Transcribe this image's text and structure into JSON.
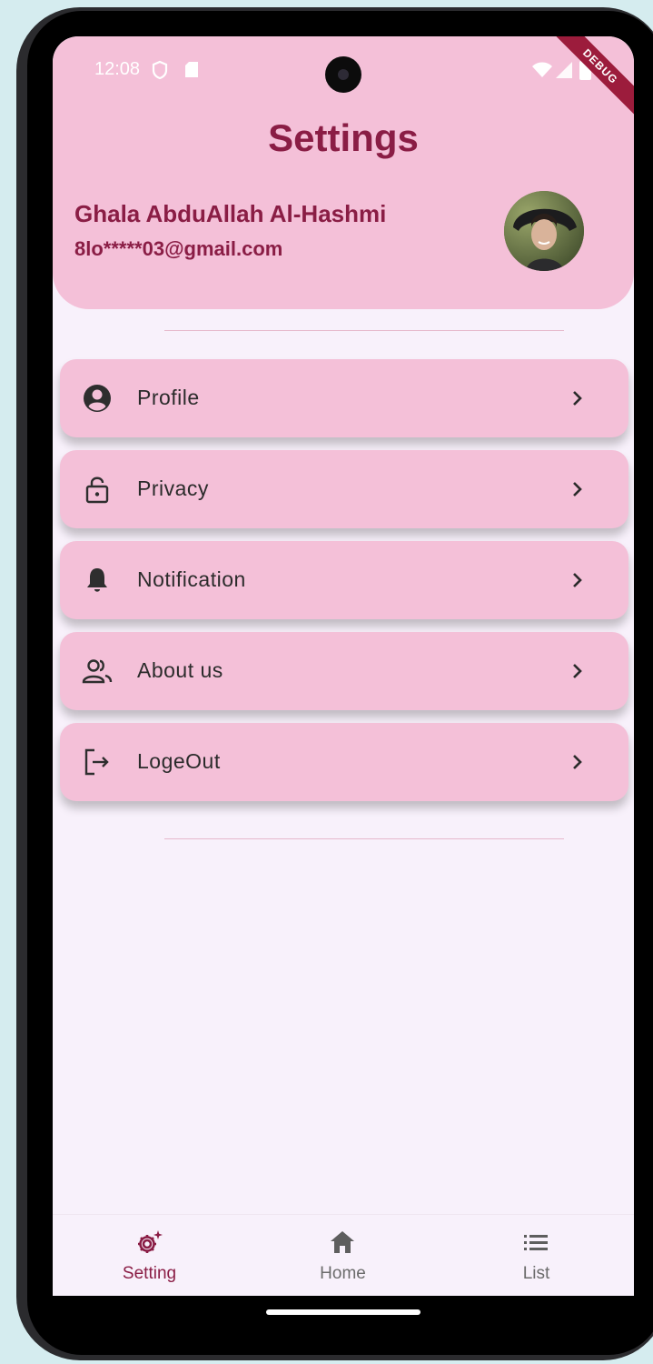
{
  "status_bar": {
    "time": "12:08",
    "debug_label": "DEBUG"
  },
  "header": {
    "title": "Settings",
    "user_name": "Ghala AbduAllah Al-Hashmi",
    "user_email": "8lo*****03@gmail.com"
  },
  "menu": {
    "items": [
      {
        "label": "Profile",
        "icon": "account-circle-icon"
      },
      {
        "label": "Privacy",
        "icon": "lock-open-icon"
      },
      {
        "label": "Notification",
        "icon": "bell-icon"
      },
      {
        "label": "About us",
        "icon": "people-icon"
      },
      {
        "label": "LogeOut",
        "icon": "logout-icon"
      }
    ]
  },
  "bottom_nav": {
    "items": [
      {
        "label": "Setting",
        "icon": "settings-sparkle-icon",
        "active": true
      },
      {
        "label": "Home",
        "icon": "home-icon",
        "active": false
      },
      {
        "label": "List",
        "icon": "list-icon",
        "active": false
      }
    ]
  },
  "colors": {
    "header_bg": "#f4c0d8",
    "accent": "#8a1d45",
    "screen_bg": "#f8f1fb",
    "nav_active": "#8a1d45",
    "nav_inactive": "#6b6b6b"
  }
}
